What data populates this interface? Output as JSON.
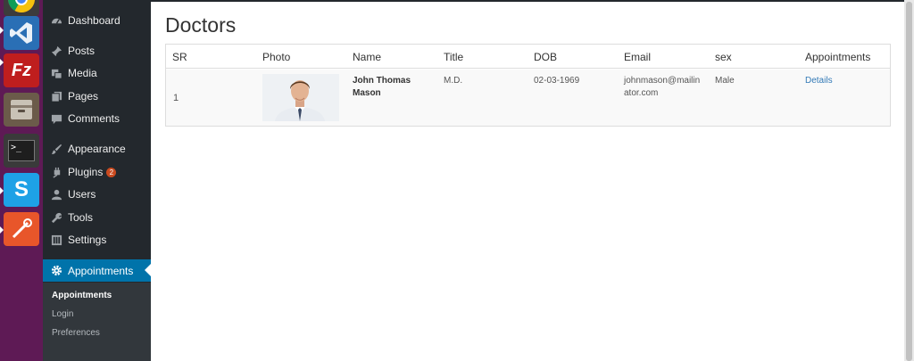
{
  "launcher": {
    "items": [
      {
        "name": "chrome",
        "icon": "chrome-icon"
      },
      {
        "name": "vscode",
        "icon": "vscode-icon"
      },
      {
        "name": "filezilla",
        "icon": "filezilla-icon",
        "glyph": "Fz"
      },
      {
        "name": "archive",
        "icon": "archive-manager-icon"
      },
      {
        "name": "terminal",
        "icon": "terminal-icon",
        "glyph": ">_"
      },
      {
        "name": "skype",
        "icon": "skype-icon",
        "glyph": "S"
      },
      {
        "name": "postman",
        "icon": "postman-icon"
      }
    ]
  },
  "sidebar": {
    "items": [
      {
        "label": "Dashboard",
        "icon": "dashboard-icon"
      },
      {
        "label": "Posts",
        "icon": "pin-icon"
      },
      {
        "label": "Media",
        "icon": "media-icon"
      },
      {
        "label": "Pages",
        "icon": "pages-icon"
      },
      {
        "label": "Comments",
        "icon": "comment-icon"
      },
      {
        "label": "Appearance",
        "icon": "brush-icon"
      },
      {
        "label": "Plugins",
        "icon": "plugin-icon",
        "badge": "2"
      },
      {
        "label": "Users",
        "icon": "user-icon"
      },
      {
        "label": "Tools",
        "icon": "wrench-icon"
      },
      {
        "label": "Settings",
        "icon": "settings-icon"
      },
      {
        "label": "Appointments",
        "icon": "gear-icon",
        "current": true
      }
    ],
    "submenu": [
      {
        "label": "Appointments",
        "current": true
      },
      {
        "label": "Login"
      },
      {
        "label": "Preferences"
      }
    ]
  },
  "main": {
    "title": "Doctors",
    "table": {
      "headers": [
        "SR",
        "Photo",
        "Name",
        "Title",
        "DOB",
        "Email",
        "sex",
        "Appointments"
      ],
      "rows": [
        {
          "sr": "1",
          "name_line1": "John Thomas",
          "name_line2": "Mason",
          "title": "M.D.",
          "dob": "02-03-1969",
          "email_line1": "johnmason@mailin",
          "email_line2": "ator.com",
          "sex": "Male",
          "action": "Details"
        }
      ]
    }
  },
  "colors": {
    "launcher_bg": "#5e1a55",
    "sidebar_bg": "#23282d",
    "submenu_bg": "#32373c",
    "accent": "#0073aa",
    "link": "#337ab7",
    "badge": "#ca4a1f"
  }
}
